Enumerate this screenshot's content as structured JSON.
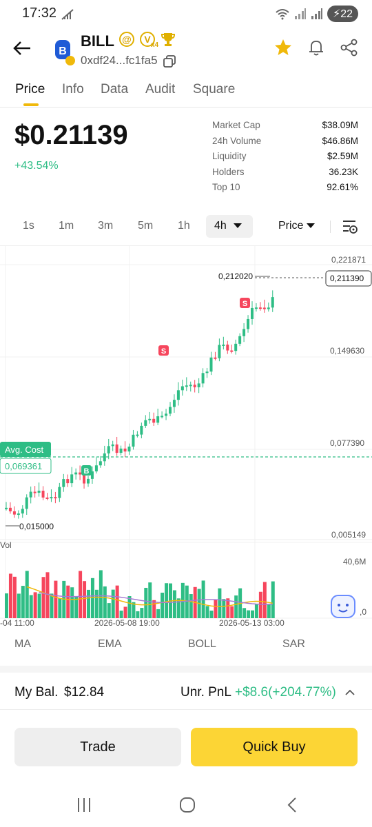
{
  "status_bar": {
    "time": "17:32",
    "battery": "22"
  },
  "header": {
    "token_name": "BILL",
    "badge_at": "@",
    "badge_v": "V",
    "badge_x4": "x4",
    "address": "0xdf24...fc1fa5"
  },
  "tabs": [
    "Price",
    "Info",
    "Data",
    "Audit",
    "Square"
  ],
  "price": {
    "value": "$0.21139",
    "change": "+43.54%"
  },
  "stats": [
    {
      "label": "Market Cap",
      "value": "$38.09M"
    },
    {
      "label": "24h Volume",
      "value": "$46.86M"
    },
    {
      "label": "Liquidity",
      "value": "$2.59M"
    },
    {
      "label": "Holders",
      "value": "36.23K"
    },
    {
      "label": "Top 10",
      "value": "92.61%"
    }
  ],
  "timeframes": {
    "items": [
      "1s",
      "1m",
      "3m",
      "5m",
      "1h"
    ],
    "active": "4h",
    "price_mode": "Price"
  },
  "chart": {
    "y_ticks": [
      "0,221871",
      "0,149630",
      "0,077390",
      "0,005149"
    ],
    "high_label": "0,212020",
    "low_label": "0,015000",
    "current_price": "0,211390",
    "avg_cost_label": "Avg. Cost",
    "avg_cost_value": "0,069361",
    "vol_label": "Vol",
    "vol_max": "40,6M",
    "vol_zero": ",0",
    "x_labels": [
      "-04 11:00",
      "2026-05-08 19:00",
      "2026-05-13 03:00"
    ],
    "marker_s": "S",
    "marker_b": "B",
    "colors": {
      "up": "#2ebd85",
      "down": "#f6465d",
      "ma1": "#f0b90b",
      "ma2": "#a77bd4"
    }
  },
  "indicators": [
    "MA",
    "EMA",
    "BOLL",
    "SAR"
  ],
  "balance": {
    "label": "My Bal.",
    "value": "$12.84",
    "pnl_label": "Unr. PnL",
    "pnl_value": "+$8.6(+204.77%)"
  },
  "actions": {
    "trade": "Trade",
    "quick_buy": "Quick Buy"
  }
}
